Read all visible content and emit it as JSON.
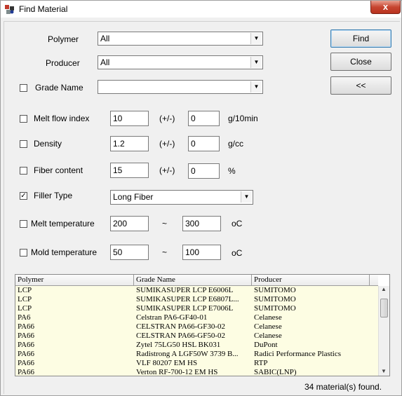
{
  "window": {
    "title": "Find Material",
    "close_symbol": "x"
  },
  "fields": {
    "polymer": {
      "label": "Polymer",
      "value": "All"
    },
    "producer": {
      "label": "Producer",
      "value": "All"
    },
    "grade_name": {
      "label": "Grade Name",
      "value": "",
      "checked": false
    }
  },
  "properties": {
    "melt_flow": {
      "label": "Melt flow index",
      "value": "10",
      "sep": "(+/-)",
      "tol": "0",
      "unit": "g/10min",
      "checked": false
    },
    "density": {
      "label": "Density",
      "value": "1.2",
      "sep": "(+/-)",
      "tol": "0",
      "unit": "g/cc",
      "checked": false
    },
    "fiber_content": {
      "label": "Fiber content",
      "value": "15",
      "sep": "(+/-)",
      "tol": "0",
      "unit": "%",
      "checked": false
    },
    "filler_type": {
      "label": "Filler Type",
      "value": "Long Fiber",
      "checked": true
    },
    "melt_temp": {
      "label": "Melt temperature",
      "min": "200",
      "sep": "~",
      "max": "300",
      "unit": "oC",
      "checked": false
    },
    "mold_temp": {
      "label": "Mold temperature",
      "min": "50",
      "sep": "~",
      "max": "100",
      "unit": "oC",
      "checked": false
    }
  },
  "buttons": {
    "find": "Find",
    "close": "Close",
    "collapse": "<<"
  },
  "grid": {
    "headers": [
      "Polymer",
      "Grade Name",
      "Producer"
    ],
    "rows": [
      [
        "LCP",
        "SUMIKASUPER LCP E6006L",
        "SUMITOMO"
      ],
      [
        "LCP",
        "SUMIKASUPER LCP E6807L...",
        "SUMITOMO"
      ],
      [
        "LCP",
        "SUMIKASUPER LCP E7006L",
        "SUMITOMO"
      ],
      [
        "PA6",
        "Celstran PA6-GF40-01",
        "Celanese"
      ],
      [
        "PA66",
        "CELSTRAN PA66-GF30-02",
        "Celanese"
      ],
      [
        "PA66",
        "CELSTRAN PA66-GF50-02",
        "Celanese"
      ],
      [
        "PA66",
        "Zytel 75LG50 HSL BK031",
        "DuPont"
      ],
      [
        "PA66",
        "Radistrong A LGF50W 3739 B...",
        "Radici Performance Plastics"
      ],
      [
        "PA66",
        "VLF 80207 EM HS",
        "RTP"
      ],
      [
        "PA66",
        "Verton RF-700-12 EM HS",
        "SABIC(LNP)"
      ]
    ]
  },
  "status": "34 material(s) found."
}
